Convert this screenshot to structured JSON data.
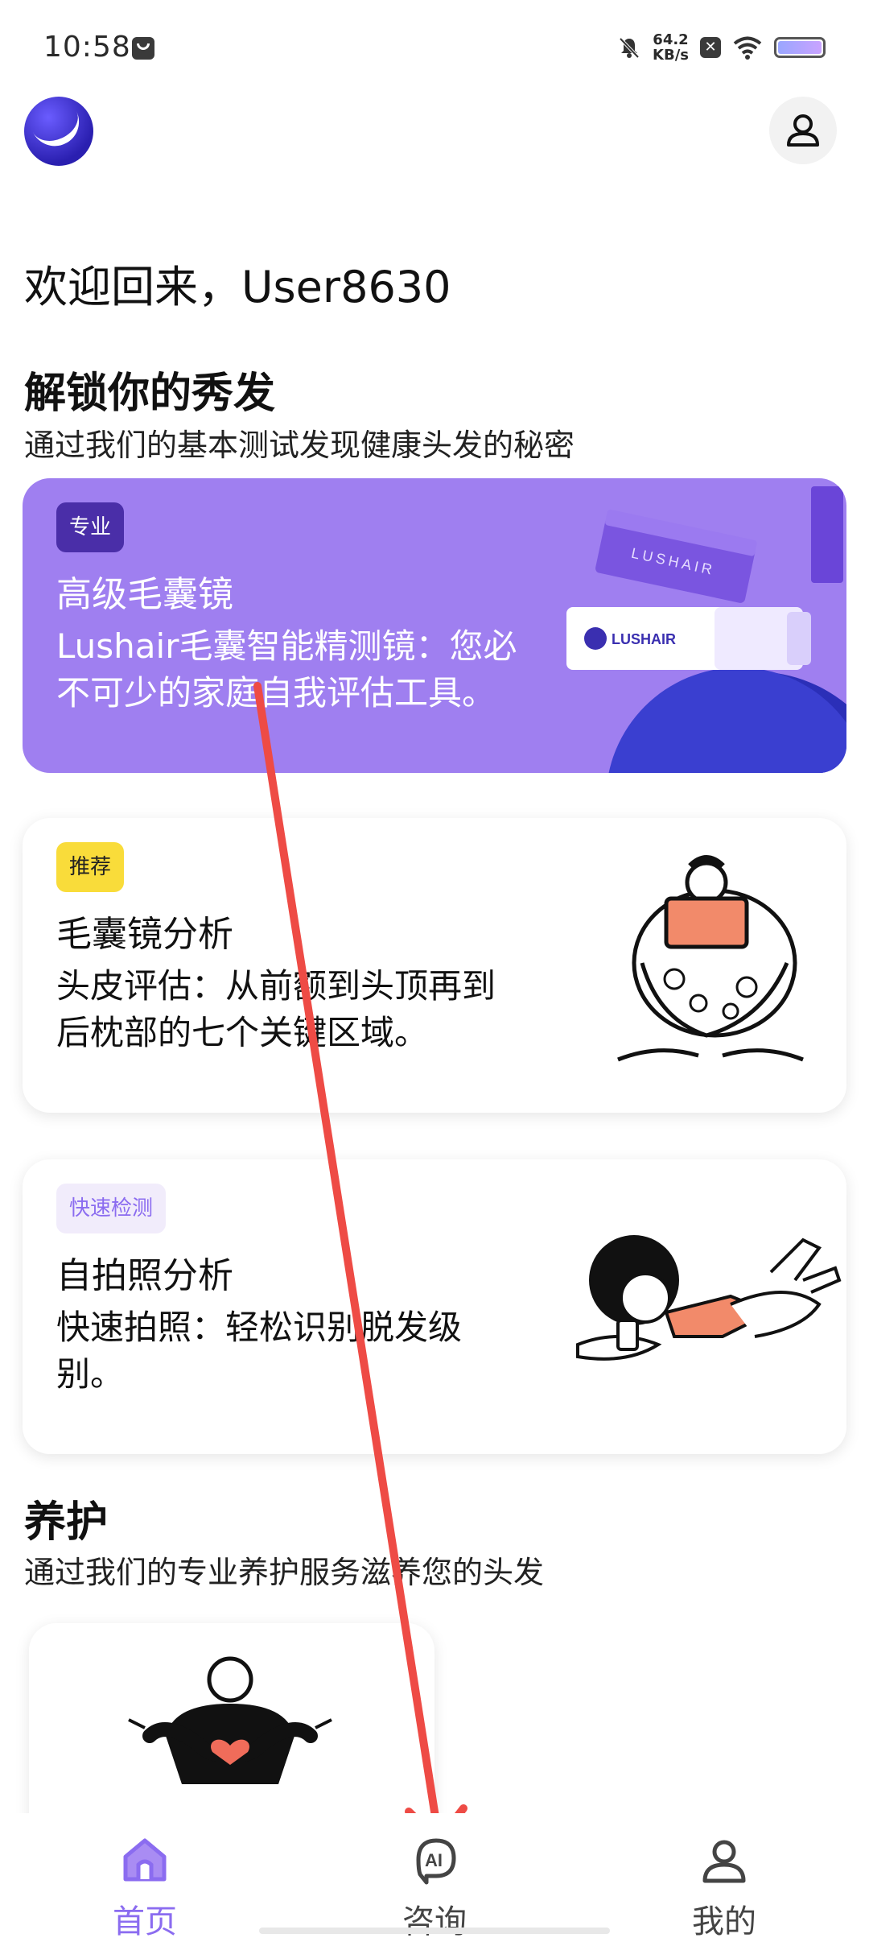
{
  "status_bar": {
    "time": "10:58",
    "speed_value": "64.2",
    "speed_unit": "KB/s",
    "x_badge": "✕"
  },
  "header": {
    "welcome": "欢迎回来，User8630"
  },
  "unlock_section": {
    "title": "解锁你的秀发",
    "subtitle": "通过我们的基本测试发现健康头发的秘密"
  },
  "cards": [
    {
      "badge": "专业",
      "title": "高级毛囊镜",
      "desc_line1": "Lushair毛囊智能精测镜：您必",
      "desc_line2": "不可少的家庭自我评估工具。",
      "product_box_text": "LUSHAIR",
      "product_tube_text": "LUSHAIR"
    },
    {
      "badge": "推荐",
      "title": "毛囊镜分析",
      "desc_line1": "头皮评估：从前额到头顶再到",
      "desc_line2": "后枕部的七个关键区域。"
    },
    {
      "badge": "快速检测",
      "title": "自拍照分析",
      "desc_line1": "快速拍照：轻松识别脱发级",
      "desc_line2": "别。"
    }
  ],
  "care_section": {
    "title": "养护",
    "subtitle": "通过我们的专业养护服务滋养您的头发"
  },
  "bottom_nav": [
    {
      "label": "首页",
      "icon": "home-icon",
      "active": true
    },
    {
      "label": "咨询",
      "icon": "ai-chat-icon",
      "icon_text": "AI",
      "active": false
    },
    {
      "label": "我的",
      "icon": "user-icon",
      "active": false
    }
  ],
  "colors": {
    "accent": "#8b6cf0",
    "purple_card": "#9f7ff0",
    "badge_pro": "#4a2ea8",
    "badge_rec": "#f9dc3a",
    "badge_quick_bg": "#f1ecfb",
    "badge_quick_text": "#8b6cf0",
    "annotation_arrow": "#ee4b45"
  }
}
